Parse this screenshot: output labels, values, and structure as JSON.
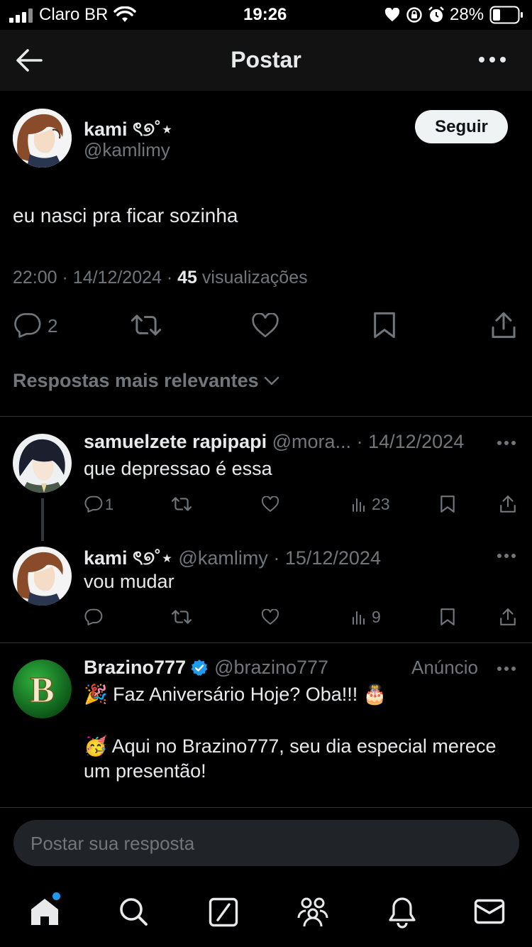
{
  "status_bar": {
    "carrier": "Claro BR",
    "time": "19:26",
    "battery": "28%",
    "icons": [
      "signal-icon",
      "wifi-icon",
      "heart-icon",
      "orientation-lock-icon",
      "alarm-icon",
      "battery-icon"
    ]
  },
  "header": {
    "title": "Postar",
    "back_icon": "arrow-left-icon",
    "more_icon": "more-icon"
  },
  "post": {
    "author_name": "kami ৎ୭˚⋆",
    "author_handle": "@kamlimy",
    "follow_label": "Seguir",
    "text": "eu nasci pra ficar sozinha",
    "time": "22:00",
    "date": "14/12/2024",
    "views_count": "45",
    "views_label": "visualizações",
    "reply_count": "2"
  },
  "sort": {
    "label": "Respostas mais relevantes"
  },
  "replies": [
    {
      "name": "samuelzete rapipapi",
      "handle": "@mora...",
      "date": "14/12/2024",
      "text": "que depressao é essa",
      "reply_count": "1",
      "views": "23"
    },
    {
      "name": "kami ৎ୭˚⋆",
      "handle": "@kamlimy",
      "date": "15/12/2024",
      "text": "vou mudar",
      "reply_count": "",
      "views": "9"
    }
  ],
  "ad": {
    "name": "Brazino777",
    "handle": "@brazino777",
    "label": "Anúncio",
    "avatar_letter": "B",
    "line1": "🎉 Faz Aniversário Hoje? Oba!!! 🎂",
    "line2": "🥳 Aqui no Brazino777, seu dia especial merece",
    "line3": "um presentão!"
  },
  "reply_box": {
    "placeholder": "Postar sua resposta"
  },
  "tabbar": {
    "items": [
      "home-icon",
      "search-icon",
      "grok-icon",
      "communities-icon",
      "notifications-icon",
      "messages-icon"
    ]
  },
  "colors": {
    "background": "#000000",
    "header_bg": "#121212",
    "text": "#e7e9ea",
    "muted": "#71767b",
    "accent": "#1d9bf0",
    "divider": "#2f3336"
  }
}
